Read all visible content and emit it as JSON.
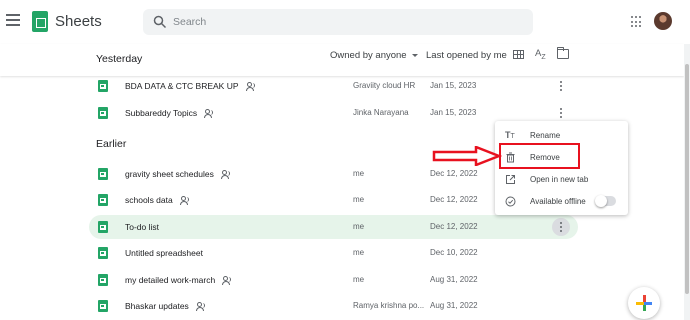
{
  "header": {
    "app_title": "Sheets",
    "search": {
      "placeholder": "Search",
      "value": ""
    },
    "icons": [
      "main-menu-icon",
      "sheets-logo-icon",
      "search-icon",
      "google-apps-icon",
      "account-avatar"
    ]
  },
  "toolbar": {
    "section_label": "Yesterday",
    "owner_filter": "Owned by anyone",
    "sort_label": "Last opened by me",
    "icons": [
      "grid-view-icon",
      "sort-az-icon",
      "folder-picker-icon"
    ]
  },
  "earlier_label": "Earlier",
  "files": [
    {
      "name": "BDA DATA & CTC BREAK UP",
      "shared": true,
      "owner": "Graviity cloud HR",
      "date": "Jan 15, 2023",
      "selected": false
    },
    {
      "name": "Subbareddy Topics",
      "shared": true,
      "owner": "Jinka Narayana",
      "date": "Jan 15, 2023",
      "selected": false
    },
    {
      "name": "gravity sheet schedules",
      "shared": true,
      "owner": "me",
      "date": "Dec 12, 2022",
      "selected": false
    },
    {
      "name": "schools data",
      "shared": true,
      "owner": "me",
      "date": "Dec 12, 2022",
      "selected": false
    },
    {
      "name": "To-do list",
      "shared": false,
      "owner": "me",
      "date": "Dec 12, 2022",
      "selected": true
    },
    {
      "name": "Untitled spreadsheet",
      "shared": false,
      "owner": "me",
      "date": "Dec 10, 2022",
      "selected": false
    },
    {
      "name": "my detailed work-march",
      "shared": true,
      "owner": "me",
      "date": "Aug 31, 2022",
      "selected": false
    },
    {
      "name": "Bhaskar updates",
      "shared": true,
      "owner": "Ramya krishna po...",
      "date": "Aug 31, 2022",
      "selected": false
    }
  ],
  "context_menu": {
    "items": [
      {
        "label": "Rename",
        "icon": "rename-icon"
      },
      {
        "label": "Remove",
        "icon": "trash-icon",
        "highlighted": true
      },
      {
        "label": "Open in new tab",
        "icon": "open-in-new-icon"
      },
      {
        "label": "Available offline",
        "icon": "offline-icon",
        "toggle": false
      }
    ]
  },
  "colors": {
    "sheets_green": "#23a566",
    "selected_row": "#e6f4ea",
    "annotation_red": "#e8111f"
  }
}
